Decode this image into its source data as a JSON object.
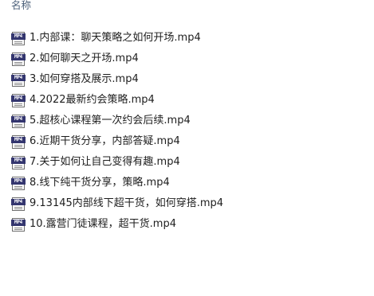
{
  "header": {
    "name_column": "名称"
  },
  "files": [
    {
      "name": "1.内部课：聊天策略之如何开场.mp4",
      "icon": "mp4-file-icon",
      "icon_label": "MP4"
    },
    {
      "name": "2.如何聊天之开场.mp4",
      "icon": "mp4-file-icon",
      "icon_label": "MP4"
    },
    {
      "name": "3.如何穿搭及展示.mp4",
      "icon": "mp4-file-icon",
      "icon_label": "MP4"
    },
    {
      "name": "4.2022最新约会策略.mp4",
      "icon": "mp4-file-icon",
      "icon_label": "MP4"
    },
    {
      "name": "5.超核心课程第一次约会后续.mp4",
      "icon": "mp4-file-icon",
      "icon_label": "MP4"
    },
    {
      "name": "6.近期干货分享，内部答疑.mp4",
      "icon": "mp4-file-icon",
      "icon_label": "MP4"
    },
    {
      "name": "7.关于如何让自己变得有趣.mp4",
      "icon": "mp4-file-icon",
      "icon_label": "MP4"
    },
    {
      "name": "8.线下纯干货分享，策略.mp4",
      "icon": "mp4-file-icon",
      "icon_label": "MP4"
    },
    {
      "name": "9.13145内部线下超干货，如何穿搭.mp4",
      "icon": "mp4-file-icon",
      "icon_label": "MP4"
    },
    {
      "name": "10.露营门徒课程，超干货.mp4",
      "icon": "mp4-file-icon",
      "icon_label": "MP4"
    }
  ],
  "colors": {
    "header_text": "#4c607a",
    "icon_band": "#34366f",
    "file_text": "#1e1e1e"
  }
}
